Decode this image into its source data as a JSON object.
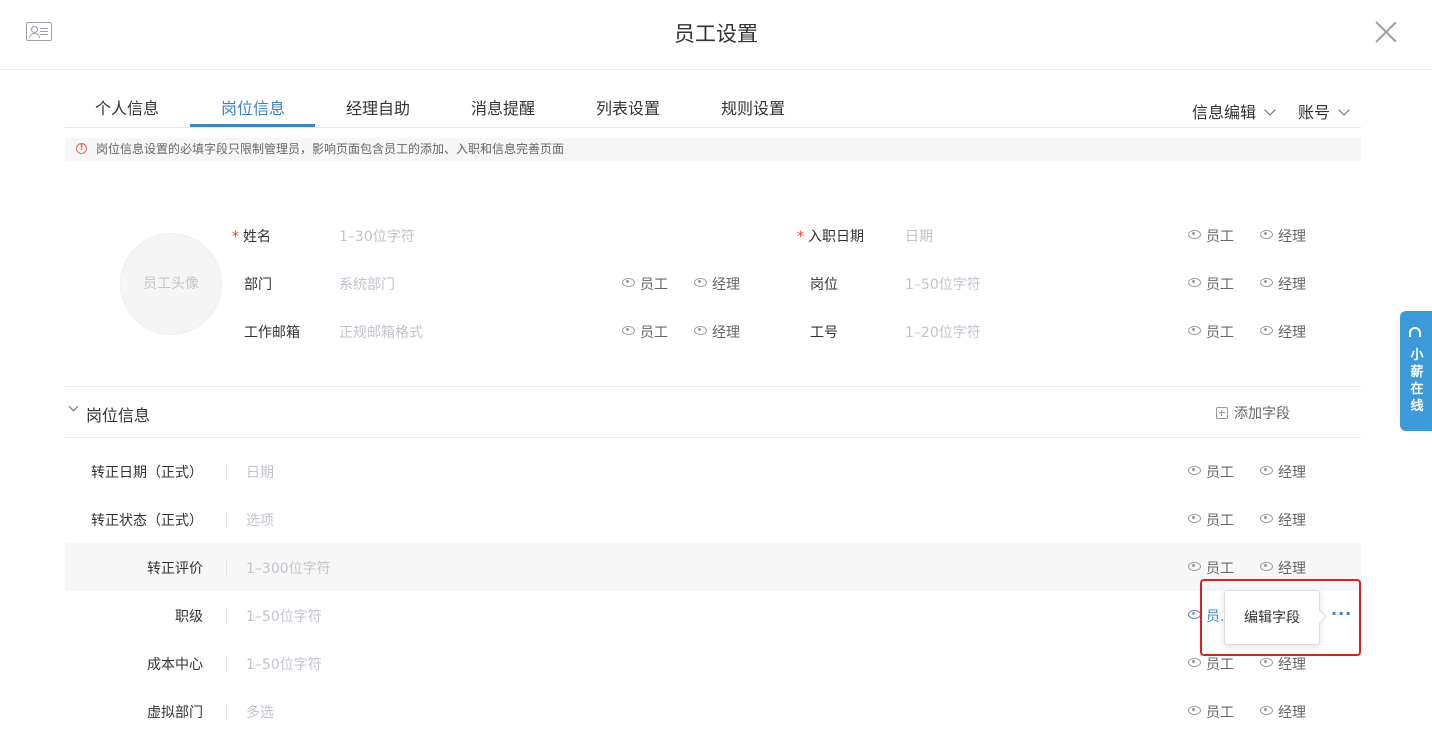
{
  "header": {
    "title": "员工设置",
    "card_icon": "id-card-icon",
    "close_icon": "close-icon"
  },
  "tabs": [
    {
      "label": "个人信息",
      "active": false
    },
    {
      "label": "岗位信息",
      "active": true
    },
    {
      "label": "经理自助",
      "active": false
    },
    {
      "label": "消息提醒",
      "active": false
    },
    {
      "label": "列表设置",
      "active": false
    },
    {
      "label": "规则设置",
      "active": false
    }
  ],
  "toolbar": {
    "info_edit": "信息编辑",
    "account": "账号"
  },
  "notice": {
    "text": "岗位信息设置的必填字段只限制管理员，影响页面包含员工的添加、入职和信息完善页面"
  },
  "basic": {
    "avatar_label": "员工头像",
    "required_mark": "*",
    "visibility": {
      "employee": "员工",
      "manager": "经理"
    },
    "fields": {
      "name": {
        "label": "姓名",
        "placeholder": "1–30位字符",
        "required": true
      },
      "hire_date": {
        "label": "入职日期",
        "placeholder": "日期",
        "required": true
      },
      "department": {
        "label": "部门",
        "placeholder": "系统部门"
      },
      "position": {
        "label": "岗位",
        "placeholder": "1–50位字符"
      },
      "email": {
        "label": "工作邮箱",
        "placeholder": "正规邮箱格式"
      },
      "employee_no": {
        "label": "工号",
        "placeholder": "1–20位字符"
      }
    }
  },
  "section": {
    "title": "岗位信息",
    "add_field": "添加字段",
    "rows": [
      {
        "label": "转正日期（正式）",
        "placeholder": "日期"
      },
      {
        "label": "转正状态（正式）",
        "placeholder": "选项"
      },
      {
        "label": "转正评价",
        "placeholder": "1–300位字符"
      },
      {
        "label": "职级",
        "placeholder": "1–50位字符"
      },
      {
        "label": "成本中心",
        "placeholder": "1–50位字符"
      },
      {
        "label": "虚拟部门",
        "placeholder": "多选"
      }
    ]
  },
  "popup": {
    "edit_field": "编辑字段",
    "truncated_employee": "员."
  },
  "side_widget": {
    "text": "小薪在线"
  }
}
